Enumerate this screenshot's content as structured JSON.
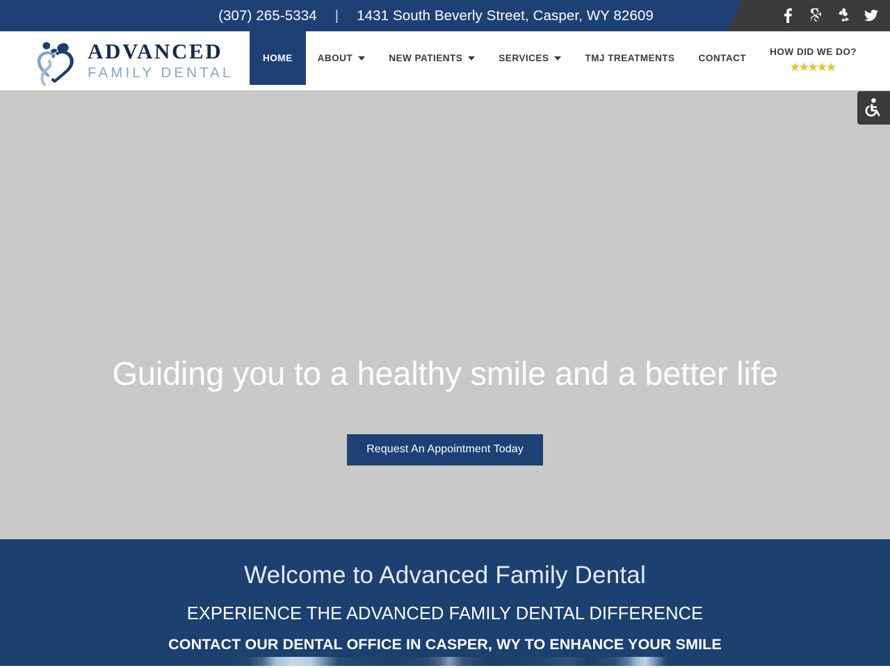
{
  "topbar": {
    "phone": "(307) 265-5334",
    "separator": "|",
    "address": "1431 South Beverly Street, Casper, WY 82609",
    "social": [
      {
        "name": "facebook-icon",
        "label": "Facebook"
      },
      {
        "name": "google-icon",
        "label": "Google"
      },
      {
        "name": "yelp-icon",
        "label": "Yelp"
      },
      {
        "name": "twitter-icon",
        "label": "Twitter"
      }
    ]
  },
  "header": {
    "logo_line1": "ADVANCED",
    "logo_line2": "FAMILY DENTAL",
    "nav": [
      {
        "label": "HOME",
        "active": true,
        "caret": false
      },
      {
        "label": "ABOUT",
        "active": false,
        "caret": true
      },
      {
        "label": "NEW PATIENTS",
        "active": false,
        "caret": true
      },
      {
        "label": "SERVICES",
        "active": false,
        "caret": true
      },
      {
        "label": "TMJ TREATMENTS",
        "active": false,
        "caret": false
      },
      {
        "label": "CONTACT",
        "active": false,
        "caret": false
      },
      {
        "label": "HOW DID WE DO?",
        "active": false,
        "caret": false,
        "stars": "★★★★★"
      }
    ]
  },
  "accessibility": {
    "label": "Accessibility Tools",
    "icon": "wheelchair-icon"
  },
  "hero": {
    "title": "Guiding you to a healthy smile and a better life",
    "cta": "Request An Appointment Today"
  },
  "welcome": {
    "heading": "Welcome to Advanced Family Dental",
    "subheading": "EXPERIENCE THE ADVANCED FAMILY DENTAL DIFFERENCE",
    "tagline": "CONTACT OUR DENTAL OFFICE IN CASPER, WY TO ENHANCE YOUR SMILE"
  },
  "colors": {
    "navy": "#1e4175",
    "navy_section": "#1c4070",
    "dark_gray": "#3b3b3b",
    "hero_placeholder": "#c9c9c9",
    "star_gold": "#e8c42a",
    "logo_light_blue": "#8ba4c4"
  }
}
